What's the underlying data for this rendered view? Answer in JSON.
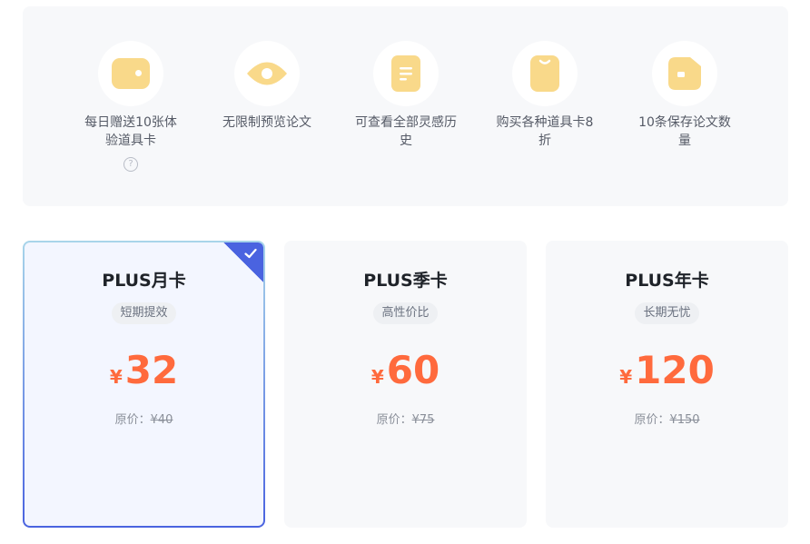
{
  "benefits": [
    {
      "label": "每日赠送10张体验道具卡",
      "icon": "wallet-icon",
      "has_help": true
    },
    {
      "label": "无限制预览论文",
      "icon": "eye-icon",
      "has_help": false
    },
    {
      "label": "可查看全部灵感历史",
      "icon": "document-icon",
      "has_help": false
    },
    {
      "label": "购买各种道具卡8折",
      "icon": "card-icon",
      "has_help": false
    },
    {
      "label": "10条保存论文数量",
      "icon": "save-icon",
      "has_help": false
    }
  ],
  "help_glyph": "?",
  "plans": [
    {
      "name": "PLUS月卡",
      "tag": "短期提效",
      "currency": "¥",
      "price": "32",
      "orig_label": "原价：",
      "orig_price": "¥40",
      "selected": true
    },
    {
      "name": "PLUS季卡",
      "tag": "高性价比",
      "currency": "¥",
      "price": "60",
      "orig_label": "原价：",
      "orig_price": "¥75",
      "selected": false
    },
    {
      "name": "PLUS年卡",
      "tag": "长期无忧",
      "currency": "¥",
      "price": "120",
      "orig_label": "原价：",
      "orig_price": "¥150",
      "selected": false
    }
  ],
  "colors": {
    "icon": "#f9d98a",
    "price": "#ff6a3d",
    "accent": "#4a63e0"
  }
}
